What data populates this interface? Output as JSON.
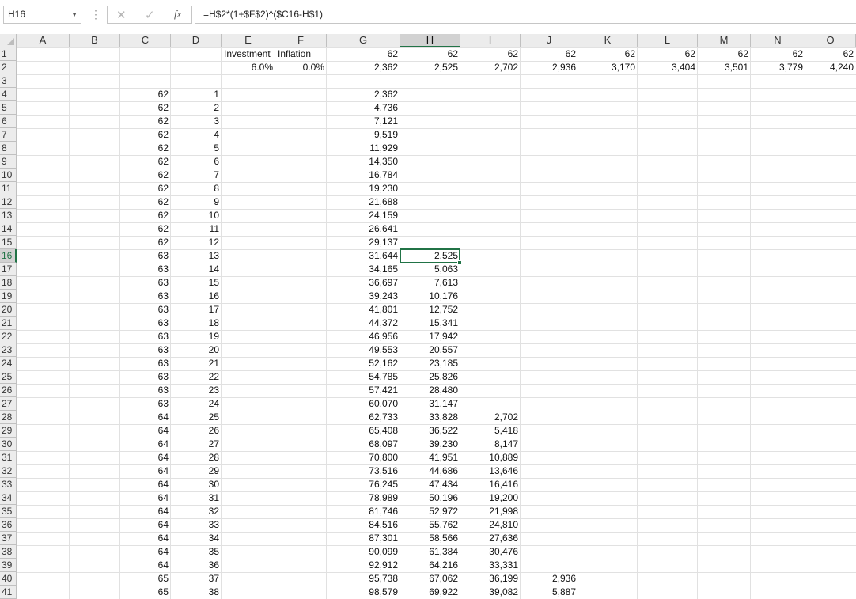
{
  "formula_bar": {
    "name_box": "H16",
    "formula": "=H$2*(1+$F$2)^($C16-H$1)",
    "fx_label": "fx",
    "icons": {
      "cancel": "close-icon",
      "enter": "check-icon",
      "function": "fx-icon",
      "dropdown": "chevron-down-icon"
    }
  },
  "active_cell": {
    "col": "H",
    "row": 16
  },
  "columns": [
    "A",
    "B",
    "C",
    "D",
    "E",
    "F",
    "G",
    "H",
    "I",
    "J",
    "K",
    "L",
    "M",
    "N",
    "O"
  ],
  "rows": [
    1,
    2,
    3,
    4,
    5,
    6,
    7,
    8,
    9,
    10,
    11,
    12,
    13,
    14,
    15,
    16,
    17,
    18,
    19,
    20,
    21,
    22,
    23,
    24,
    25,
    26,
    27,
    28,
    29,
    30,
    31,
    32,
    33,
    34,
    35,
    36,
    37,
    38,
    39,
    40,
    41
  ],
  "header_row": {
    "E1": "Investment",
    "F1": "Inflation",
    "G1": "62",
    "H1": "62",
    "I1": "62",
    "J1": "62",
    "K1": "62",
    "L1": "62",
    "M1": "62",
    "N1": "62",
    "O1": "62",
    "E2": "6.0%",
    "F2": "0.0%",
    "G2": "2,362",
    "H2": "2,525",
    "I2": "2,702",
    "J2": "2,936",
    "K2": "3,170",
    "L2": "3,404",
    "M2": "3,501",
    "N2": "3,779",
    "O2": "4,240"
  },
  "column_C": [
    "62",
    "62",
    "62",
    "62",
    "62",
    "62",
    "62",
    "62",
    "62",
    "62",
    "62",
    "62",
    "63",
    "63",
    "63",
    "63",
    "63",
    "63",
    "63",
    "63",
    "63",
    "63",
    "63",
    "63",
    "64",
    "64",
    "64",
    "64",
    "64",
    "64",
    "64",
    "64",
    "64",
    "64",
    "64",
    "64",
    "65",
    "65"
  ],
  "column_D": [
    "1",
    "2",
    "3",
    "4",
    "5",
    "6",
    "7",
    "8",
    "9",
    "10",
    "11",
    "12",
    "13",
    "14",
    "15",
    "16",
    "17",
    "18",
    "19",
    "20",
    "21",
    "22",
    "23",
    "24",
    "25",
    "26",
    "27",
    "28",
    "29",
    "30",
    "31",
    "32",
    "33",
    "34",
    "35",
    "36",
    "37",
    "38"
  ],
  "column_G": [
    "2,362",
    "4,736",
    "7,121",
    "9,519",
    "11,929",
    "14,350",
    "16,784",
    "19,230",
    "21,688",
    "24,159",
    "26,641",
    "29,137",
    "31,644",
    "34,165",
    "36,697",
    "39,243",
    "41,801",
    "44,372",
    "46,956",
    "49,553",
    "52,162",
    "54,785",
    "57,421",
    "60,070",
    "62,733",
    "65,408",
    "68,097",
    "70,800",
    "73,516",
    "76,245",
    "78,989",
    "81,746",
    "84,516",
    "87,301",
    "90,099",
    "92,912",
    "95,738",
    "98,579"
  ],
  "column_H": [
    "2,525",
    "5,063",
    "7,613",
    "10,176",
    "12,752",
    "15,341",
    "17,942",
    "20,557",
    "23,185",
    "25,826",
    "28,480",
    "31,147",
    "33,828",
    "36,522",
    "39,230",
    "41,951",
    "44,686",
    "47,434",
    "50,196",
    "52,972",
    "55,762",
    "58,566",
    "61,384",
    "64,216",
    "67,062",
    "69,922"
  ],
  "column_I": [
    "2,702",
    "5,418",
    "8,147",
    "10,889",
    "13,646",
    "16,416",
    "19,200",
    "21,998",
    "24,810",
    "27,636",
    "30,476",
    "33,331",
    "36,199",
    "39,082"
  ],
  "column_J": [
    "2,936",
    "5,887"
  ]
}
